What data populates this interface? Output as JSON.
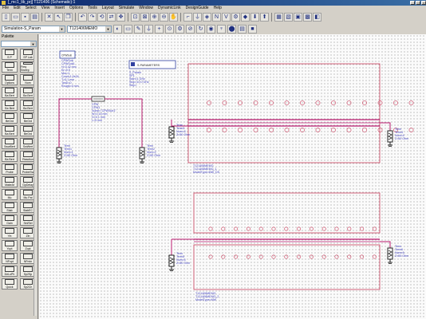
{
  "window": {
    "title": "[_mc1_lib_prj] T121406 (Schematic):1"
  },
  "menu": [
    "File",
    "Edit",
    "Select",
    "View",
    "Insert",
    "Options",
    "Tools",
    "Layout",
    "Simulate",
    "Window",
    "DynamicLink",
    "DesignGuide",
    "Help"
  ],
  "toolbar2": {
    "sim_combo": "Simulation-S_Param",
    "comp_combo": "T121406MEMO"
  },
  "palette": {
    "title": "Palette",
    "items": [
      "S P",
      "SP Lab",
      "Term",
      "Freq Sweep",
      "Options",
      "Nom",
      "Ba Bert",
      "Ba Bert",
      "Sw Bert",
      "Ba Bert",
      "BeGrd",
      "BeGrd",
      "Ba Bert",
      "BeGrd",
      "SwwBert",
      "SwWert",
      "Ba Bert",
      "Reaction",
      "Probe",
      "ProbeSw",
      "MakeAt",
      "GpDelay",
      "Mu",
      "Mu Pat",
      "Stab",
      "StabEC",
      "Gain",
      "Sel/Sel",
      "Yin",
      "Zin",
      "Yopt",
      "Zopt",
      "NFopt",
      "NFmin",
      "DeLoPh",
      "Sp2Sp",
      "Quick",
      "Sp2Ch"
    ]
  },
  "schematic": {
    "cpw_sub": {
      "title": "CPWSub",
      "name": "CPWSub1",
      "params": [
        "H=0.42 mm",
        "Er=9.9",
        "Mur=1",
        "Cond=1.0e34",
        "T=0.1 mm",
        "TanD=0",
        "Rough=0 mm"
      ]
    },
    "sp_box": {
      "title": "S-PARAMETERS",
      "name": "S_Param",
      "params": [
        "SP1",
        "Start=1 GHz",
        "Stop=10.0 GHz",
        "Step="
      ]
    },
    "cpw": {
      "name": "CPW",
      "params": [
        "CPW1",
        "Subst=\"CPWSub1\"",
        "W=0.15 mm",
        "G=0.1 mm",
        "L=5 mm"
      ]
    },
    "terms": [
      {
        "name": "Term",
        "params": [
          "Term1",
          "Num=1",
          "Z=50 Ohm"
        ]
      },
      {
        "name": "Term",
        "params": [
          "Term2",
          "Num=2",
          "Z=50 Ohm"
        ]
      },
      {
        "name": "Term",
        "params": [
          "Term3",
          "Num=3",
          "Z=50 Ohm"
        ]
      },
      {
        "name": "Term",
        "params": [
          "Term4",
          "Num=4",
          "Z=50 Ohm"
        ]
      },
      {
        "name": "Term",
        "params": [
          "Term5",
          "Num=5",
          "Z=50 Ohm"
        ]
      },
      {
        "name": "Term",
        "params": [
          "Term6",
          "Num=6",
          "Z=50 Ohm"
        ]
      }
    ],
    "block1": {
      "params": [
        "T121406MEMO",
        "T121406MEMO_1",
        "ModelType=MW_DS"
      ]
    },
    "block2": {
      "params": [
        "T121406MEMO",
        "T121406MEMO_2",
        "ModelType=MW"
      ]
    }
  },
  "colors": {
    "wire": "#b8186e",
    "block": "#c83c5a",
    "text": "#4040c0",
    "title_bar": "#0a246a"
  }
}
